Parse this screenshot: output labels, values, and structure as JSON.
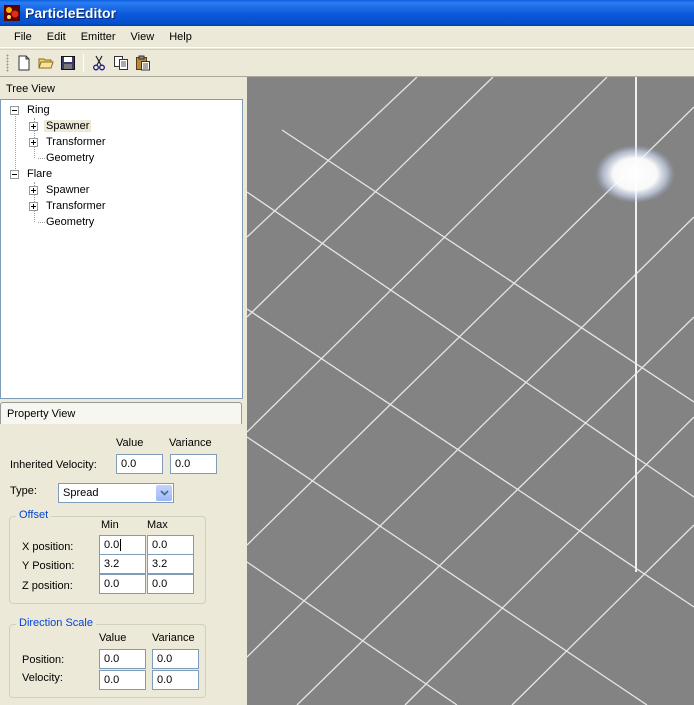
{
  "window": {
    "title": "ParticleEditor"
  },
  "menu": {
    "items": [
      "File",
      "Edit",
      "Emitter",
      "View",
      "Help"
    ]
  },
  "toolbar": {
    "icons": [
      "new-file-icon",
      "open-folder-icon",
      "save-icon",
      "cut-icon",
      "copy-icon",
      "paste-icon"
    ]
  },
  "tree": {
    "header": "Tree View",
    "nodes": [
      {
        "label": "Ring",
        "children": [
          "Spawner",
          "Transformer",
          "Geometry"
        ]
      },
      {
        "label": "Flare",
        "children": [
          "Spawner",
          "Transformer",
          "Geometry"
        ]
      }
    ],
    "selected": "Ring/Spawner"
  },
  "property": {
    "tab": "Property View",
    "col_value": "Value",
    "col_variance": "Variance",
    "inherited_label": "Inherited Velocity:",
    "inherited_value": "0.0",
    "inherited_variance": "0.0",
    "type_label": "Type:",
    "type_value": "Spread",
    "offset": {
      "title": "Offset",
      "col_min": "Min",
      "col_max": "Max",
      "rows": [
        {
          "label": "X position:",
          "min": "0.0",
          "max": "0.0"
        },
        {
          "label": "Y Position:",
          "min": "3.2",
          "max": "3.2"
        },
        {
          "label": "Z position:",
          "min": "0.0",
          "max": "0.0"
        }
      ]
    },
    "direction": {
      "title": "Direction Scale",
      "col_value": "Value",
      "col_variance": "Variance",
      "rows": [
        {
          "label": "Position:",
          "value": "0.0",
          "variance": "0.0"
        },
        {
          "label": "Velocity:",
          "value": "0.0",
          "variance": "0.0"
        }
      ]
    }
  },
  "colors": {
    "titlebar": "#0a58d8",
    "viewport_bg": "#838383",
    "grid": "#e6e6e6",
    "group_title": "#0046d5"
  }
}
